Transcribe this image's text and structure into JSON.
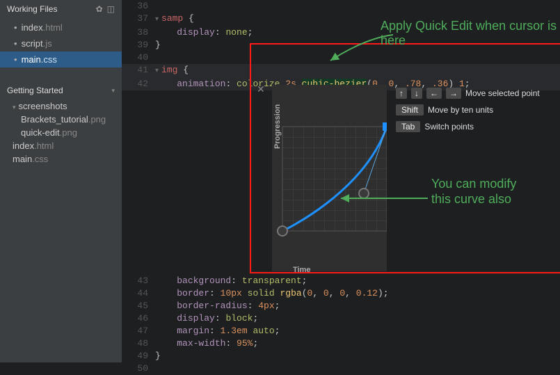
{
  "sidebar": {
    "workingFiles": {
      "title": "Working Files",
      "items": [
        {
          "name": "index",
          "ext": ".html",
          "active": false
        },
        {
          "name": "script",
          "ext": ".js",
          "active": false
        },
        {
          "name": "main",
          "ext": ".css",
          "active": true
        }
      ]
    },
    "project": {
      "title": "Getting Started",
      "folders": [
        {
          "name": "screenshots",
          "items": [
            {
              "name": "Brackets_tutorial",
              "ext": ".png"
            },
            {
              "name": "quick-edit",
              "ext": ".png"
            }
          ]
        }
      ],
      "rootItems": [
        {
          "name": "index",
          "ext": ".html"
        },
        {
          "name": "main",
          "ext": ".css"
        }
      ]
    }
  },
  "code": {
    "lines": [
      {
        "n": 36,
        "seg": []
      },
      {
        "n": 37,
        "fold": true,
        "seg": [
          [
            "tag",
            "samp"
          ],
          [
            "b",
            " {"
          ]
        ]
      },
      {
        "n": 38,
        "seg": [
          [
            "sp",
            "    "
          ],
          [
            "prop",
            "display"
          ],
          [
            "col",
            ": "
          ],
          [
            "val",
            "none"
          ],
          [
            "b",
            ";"
          ]
        ]
      },
      {
        "n": 39,
        "seg": [
          [
            "b",
            "}"
          ]
        ]
      },
      {
        "n": 40,
        "seg": []
      },
      {
        "n": 41,
        "fold": true,
        "hl": true,
        "seg": [
          [
            "tag",
            "img"
          ],
          [
            "b",
            " {"
          ]
        ]
      },
      {
        "n": 42,
        "hl": true,
        "seg": [
          [
            "sp",
            "    "
          ],
          [
            "prop",
            "animation"
          ],
          [
            "col",
            ": "
          ],
          [
            "val",
            "colorize "
          ],
          [
            "unit",
            "2s "
          ],
          [
            "fnh",
            "cubic-bezier"
          ],
          [
            "b",
            "("
          ],
          [
            "num",
            "0"
          ],
          [
            "b",
            ", "
          ],
          [
            "num",
            "0"
          ],
          [
            "b",
            ", "
          ],
          [
            "num",
            ".78"
          ],
          [
            "b",
            ", "
          ],
          [
            "num",
            ".36"
          ],
          [
            "b",
            ") "
          ],
          [
            "num",
            "1"
          ],
          [
            "b",
            ";"
          ]
        ]
      }
    ],
    "linesAfter": [
      {
        "n": 43,
        "seg": [
          [
            "sp",
            "    "
          ],
          [
            "prop",
            "background"
          ],
          [
            "col",
            ": "
          ],
          [
            "val",
            "transparent"
          ],
          [
            "b",
            ";"
          ]
        ]
      },
      {
        "n": 44,
        "seg": [
          [
            "sp",
            "    "
          ],
          [
            "prop",
            "border"
          ],
          [
            "col",
            ": "
          ],
          [
            "unit",
            "10px "
          ],
          [
            "val",
            "solid "
          ],
          [
            "fn",
            "rgba"
          ],
          [
            "b",
            "("
          ],
          [
            "num",
            "0"
          ],
          [
            "b",
            ", "
          ],
          [
            "num",
            "0"
          ],
          [
            "b",
            ", "
          ],
          [
            "num",
            "0"
          ],
          [
            "b",
            ", "
          ],
          [
            "num",
            "0.12"
          ],
          [
            "b",
            ");"
          ]
        ]
      },
      {
        "n": 45,
        "seg": [
          [
            "sp",
            "    "
          ],
          [
            "prop",
            "border-radius"
          ],
          [
            "col",
            ": "
          ],
          [
            "unit",
            "4px"
          ],
          [
            "b",
            ";"
          ]
        ]
      },
      {
        "n": 46,
        "seg": [
          [
            "sp",
            "    "
          ],
          [
            "prop",
            "display"
          ],
          [
            "col",
            ": "
          ],
          [
            "val",
            "block"
          ],
          [
            "b",
            ";"
          ]
        ]
      },
      {
        "n": 47,
        "seg": [
          [
            "sp",
            "    "
          ],
          [
            "prop",
            "margin"
          ],
          [
            "col",
            ": "
          ],
          [
            "unit",
            "1.3em "
          ],
          [
            "val",
            "auto"
          ],
          [
            "b",
            ";"
          ]
        ]
      },
      {
        "n": 48,
        "seg": [
          [
            "sp",
            "    "
          ],
          [
            "prop",
            "max-width"
          ],
          [
            "col",
            ": "
          ],
          [
            "unit",
            "95%"
          ],
          [
            "b",
            ";"
          ]
        ]
      },
      {
        "n": 49,
        "seg": [
          [
            "b",
            "}"
          ]
        ]
      },
      {
        "n": 50,
        "seg": []
      }
    ]
  },
  "quickedit": {
    "axisY": "Progression",
    "axisX": "Time",
    "hints": [
      {
        "keys": [
          "↑",
          "↓",
          "←",
          "→"
        ],
        "text": "Move selected point"
      },
      {
        "keys": [
          "Shift"
        ],
        "text": "Move by ten units"
      },
      {
        "keys": [
          "Tab"
        ],
        "text": "Switch points"
      }
    ],
    "bezier": {
      "p1x": 0,
      "p1y": 0,
      "p2x": 0.78,
      "p2y": 0.36
    }
  },
  "annotations": {
    "top": "Apply Quick Edit when cursor is here",
    "side": "You can modify this curve also"
  }
}
